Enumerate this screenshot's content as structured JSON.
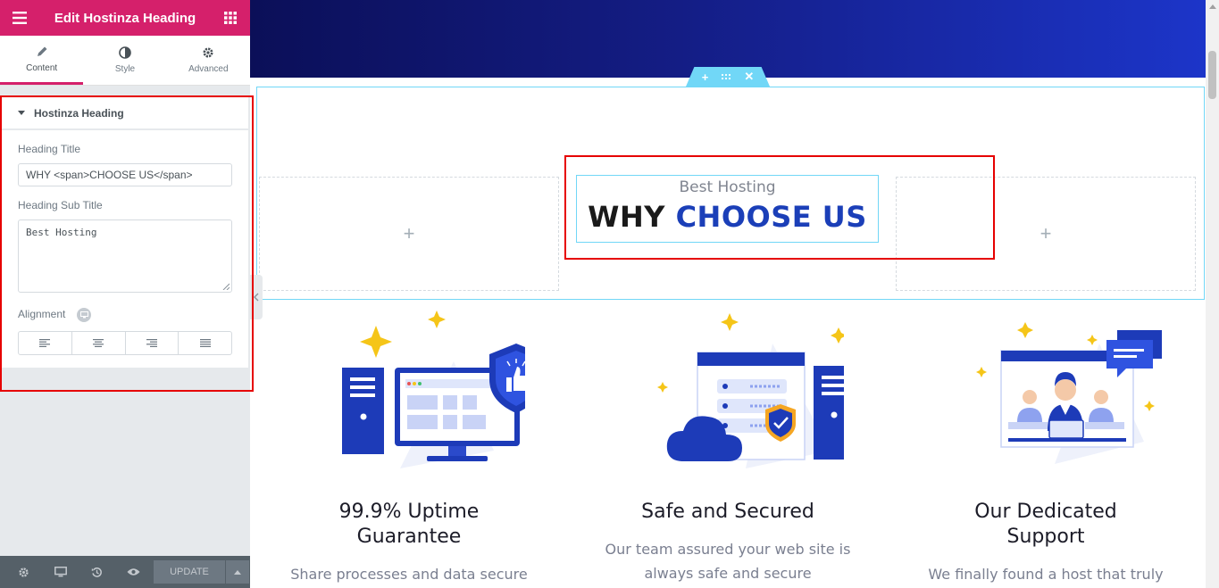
{
  "panel": {
    "title": "Edit Hostinza Heading",
    "tabs": [
      {
        "label": "Content",
        "icon": "pencil-icon",
        "active": true
      },
      {
        "label": "Style",
        "icon": "contrast-icon"
      },
      {
        "label": "Advanced",
        "icon": "gear-icon"
      }
    ],
    "section_title": "Hostinza Heading",
    "heading_title_label": "Heading Title",
    "heading_title_value": "WHY <span>CHOOSE US</span>",
    "sub_title_label": "Heading Sub Title",
    "sub_title_value": "Best Hosting",
    "alignment_label": "Alignment",
    "footer": {
      "update_label": "UPDATE"
    }
  },
  "preview": {
    "heading": {
      "subtitle": "Best Hosting",
      "title_plain": "WHY",
      "title_accent": "CHOOSE US"
    },
    "features": [
      {
        "title": "99.9% Uptime Guarantee",
        "desc": "Share processes and data secure"
      },
      {
        "title": "Safe and Secured",
        "desc": "Our team assured your web site is always safe and secure"
      },
      {
        "title": "Our Dedicated Support",
        "desc": "We finally found a host that truly understood the unique"
      }
    ]
  },
  "colors": {
    "brand": "#d5206b",
    "accent_blue": "#1b3fb8",
    "highlight_red": "#e60000",
    "editor_cyan": "#71d7f7"
  }
}
